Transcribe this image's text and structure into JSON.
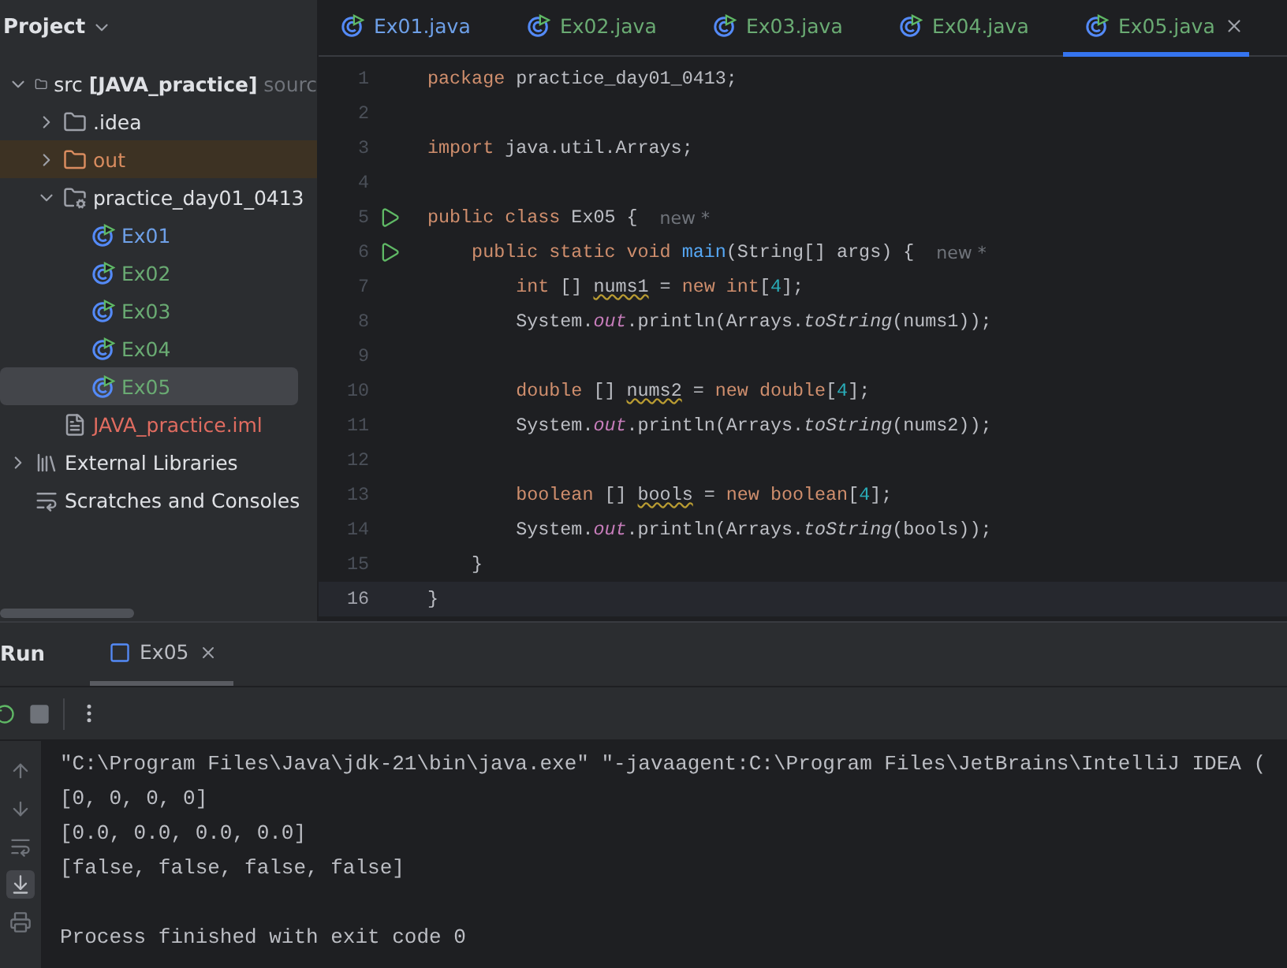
{
  "sidebar": {
    "title": "Project",
    "tree": [
      {
        "label": "src",
        "bold_suffix": "[JAVA_practice]",
        "suffix": "sourc",
        "kind": "source-root",
        "expanded": true,
        "selected": false,
        "children": [
          {
            "label": ".idea",
            "kind": "folder",
            "expanded": false,
            "selected": false
          },
          {
            "label": "out",
            "kind": "excluded",
            "expanded": false,
            "selected": false,
            "color": "#d98c5f"
          },
          {
            "label": "practice_day01_0413",
            "kind": "package",
            "expanded": true,
            "selected": false,
            "children": [
              {
                "label": "Ex01",
                "kind": "class",
                "selected": false,
                "color": "#6ea0e8"
              },
              {
                "label": "Ex02",
                "kind": "class",
                "selected": false,
                "color": "#6aab73"
              },
              {
                "label": "Ex03",
                "kind": "class",
                "selected": false,
                "color": "#6aab73"
              },
              {
                "label": "Ex04",
                "kind": "class",
                "selected": false,
                "color": "#6aab73"
              },
              {
                "label": "Ex05",
                "kind": "class",
                "selected": true,
                "color": "#6aab73"
              }
            ]
          },
          {
            "label": "JAVA_practice.iml",
            "kind": "file",
            "selected": false,
            "color": "#e06c60"
          }
        ]
      },
      {
        "label": "External Libraries",
        "kind": "library",
        "expanded": false,
        "selected": false
      },
      {
        "label": "Scratches and Consoles",
        "kind": "scratches",
        "selected": false
      }
    ]
  },
  "tabs": [
    {
      "label": "Ex01.java",
      "selected": false,
      "color": "#6ea0e8"
    },
    {
      "label": "Ex02.java",
      "selected": false,
      "color": "#6aab73"
    },
    {
      "label": "Ex03.java",
      "selected": false,
      "color": "#6aab73"
    },
    {
      "label": "Ex04.java",
      "selected": false,
      "color": "#6aab73"
    },
    {
      "label": "Ex05.java",
      "selected": true,
      "color": "#6aab73"
    }
  ],
  "code": [
    {
      "number": "1",
      "tokens": [
        {
          "t": "package",
          "kind": "keyword"
        },
        {
          "t": " practice_day01_0413;",
          "kind": "plain"
        }
      ]
    },
    {
      "number": "2"
    },
    {
      "number": "3",
      "tokens": [
        {
          "t": "import",
          "kind": "keyword"
        },
        {
          "t": " java.util.Arrays;",
          "kind": "plain"
        }
      ]
    },
    {
      "number": "4"
    },
    {
      "number": "5",
      "run": true,
      "hint": "new *",
      "tokens": [
        {
          "t": "public class",
          "kind": "keyword"
        },
        {
          "t": " Ex05 {",
          "kind": "plain"
        }
      ]
    },
    {
      "number": "6",
      "run": true,
      "hint": "new *",
      "tokens": [
        {
          "t": "    public static void ",
          "kind": "keyword"
        },
        {
          "t": "main",
          "kind": "method"
        },
        {
          "t": "(String[] args) {",
          "kind": "plain"
        }
      ]
    },
    {
      "number": "7",
      "tokens": [
        {
          "t": "        int",
          "kind": "keyword"
        },
        {
          "t": " [] ",
          "kind": "plain"
        },
        {
          "t": "nums1",
          "kind": "warning"
        },
        {
          "t": " = ",
          "kind": "plain"
        },
        {
          "t": "new int",
          "kind": "keyword"
        },
        {
          "t": "[",
          "kind": "plain"
        },
        {
          "t": "4",
          "kind": "number"
        },
        {
          "t": "];",
          "kind": "plain"
        }
      ]
    },
    {
      "number": "8",
      "tokens": [
        {
          "t": "        System.",
          "kind": "plain"
        },
        {
          "t": "out",
          "kind": "field"
        },
        {
          "t": ".println(Arrays.",
          "kind": "plain"
        },
        {
          "t": "toString",
          "kind": "static"
        },
        {
          "t": "(nums1));",
          "kind": "plain"
        }
      ]
    },
    {
      "number": "9"
    },
    {
      "number": "10",
      "tokens": [
        {
          "t": "        double",
          "kind": "keyword"
        },
        {
          "t": " [] ",
          "kind": "plain"
        },
        {
          "t": "nums2",
          "kind": "warning"
        },
        {
          "t": " = ",
          "kind": "plain"
        },
        {
          "t": "new double",
          "kind": "keyword"
        },
        {
          "t": "[",
          "kind": "plain"
        },
        {
          "t": "4",
          "kind": "number"
        },
        {
          "t": "];",
          "kind": "plain"
        }
      ]
    },
    {
      "number": "11",
      "tokens": [
        {
          "t": "        System.",
          "kind": "plain"
        },
        {
          "t": "out",
          "kind": "field"
        },
        {
          "t": ".println(Arrays.",
          "kind": "plain"
        },
        {
          "t": "toString",
          "kind": "static"
        },
        {
          "t": "(nums2));",
          "kind": "plain"
        }
      ]
    },
    {
      "number": "12"
    },
    {
      "number": "13",
      "tokens": [
        {
          "t": "        boolean",
          "kind": "keyword"
        },
        {
          "t": " [] ",
          "kind": "plain"
        },
        {
          "t": "bools",
          "kind": "warning"
        },
        {
          "t": " = ",
          "kind": "plain"
        },
        {
          "t": "new boolean",
          "kind": "keyword"
        },
        {
          "t": "[",
          "kind": "plain"
        },
        {
          "t": "4",
          "kind": "number"
        },
        {
          "t": "];",
          "kind": "plain"
        }
      ]
    },
    {
      "number": "14",
      "tokens": [
        {
          "t": "        System.",
          "kind": "plain"
        },
        {
          "t": "out",
          "kind": "field"
        },
        {
          "t": ".println(Arrays.",
          "kind": "plain"
        },
        {
          "t": "toString",
          "kind": "static"
        },
        {
          "t": "(bools));",
          "kind": "plain"
        }
      ]
    },
    {
      "number": "15",
      "tokens": [
        {
          "t": "    }",
          "kind": "plain"
        }
      ]
    },
    {
      "number": "16",
      "current": true,
      "tokens": [
        {
          "t": "}",
          "kind": "plain"
        }
      ]
    }
  ],
  "run_panel": {
    "title": "Run",
    "tabs": [
      {
        "label": "Ex05",
        "selected": true
      }
    ],
    "console": [
      {
        "kind": "output",
        "text": "\"C:\\Program Files\\Java\\jdk-21\\bin\\java.exe\" \"-javaagent:C:\\Program Files\\JetBrains\\IntelliJ IDEA ("
      },
      {
        "kind": "output",
        "text": "[0, 0, 0, 0]"
      },
      {
        "kind": "output",
        "text": "[0.0, 0.0, 0.0, 0.0]"
      },
      {
        "kind": "output",
        "text": "[false, false, false, false]"
      },
      {
        "kind": "blank"
      },
      {
        "kind": "output",
        "text": "Process finished with exit code 0"
      }
    ]
  }
}
